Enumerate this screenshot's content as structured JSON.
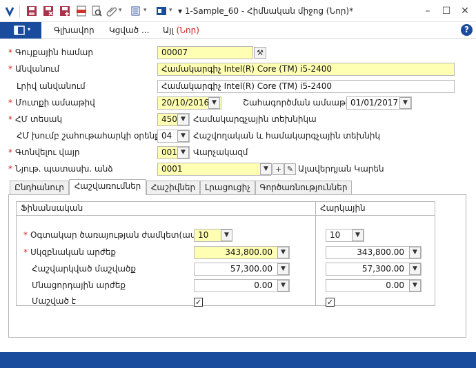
{
  "window": {
    "title": "▾ 1-Sample_60 - Հիմնական միջոց (Նոր)*",
    "minimize": "–",
    "maximize": "☐",
    "close": "✕"
  },
  "menu": {
    "items": [
      "Գլխավոր",
      "Կցված ...",
      "Այլ"
    ],
    "new_suffix": "(Նոր)",
    "help": "?"
  },
  "form": {
    "inventory_label": "Գույքային համար",
    "inventory_value": "00007",
    "name_label": "Անվանում",
    "name_value": "Համակարգիչ Intel(R) Core (TM) i5-2400",
    "fullname_label": "Լրիվ անվանում",
    "fullname_value": "Համակարգիչ Intel(R) Core (TM) i5-2400",
    "entry_date_label": "Մուտքի ամսաթիվ",
    "entry_date_value": "20/10/2016",
    "use_date_label": "Շահագործման ամսաթիվ",
    "use_date_value": "01/01/2017",
    "type_label": "ՀՄ տեսակ",
    "type_value": "450",
    "type_desc": "Համակարգչային տեխնիկա",
    "group_label": "ՀՄ խումբ շահութահարկի օրենքով",
    "group_value": "04",
    "group_desc": "Հաշվողական և համակարգչային տեխնիկ",
    "location_label": "Գտնվելու վայր",
    "location_value": "001",
    "location_desc": "Վարչակազմ",
    "responsible_label": "Նյութ. պատասխ. անձ",
    "responsible_value": "0001",
    "responsible_desc": "Ալավերդյան Կարեն",
    "required_mark": "*"
  },
  "tabs": [
    "Ընդհանուր",
    "Հաշվառումներ",
    "Հաշիվներ",
    "Լրացուցիչ",
    "Գործառնություններ"
  ],
  "financial": {
    "title": "Ֆինանսական",
    "life_label": "Օգտակար ծառայության ժամկետ(ամիս)",
    "life_value": "10",
    "initial_label": "Սկզբնական արժեք",
    "initial_value": "343,800.00",
    "depreciation_label": "Հաշվարկված մաշվածք",
    "depreciation_value": "57,300.00",
    "residual_label": "Մնացորդային արժեք",
    "residual_value": "0.00",
    "worn_label": "Մաշված է",
    "worn_checked": "✓"
  },
  "tax": {
    "title": "Հարկային",
    "life_value": "10",
    "initial_value": "343,800.00",
    "depreciation_value": "57,300.00",
    "residual_value": "0.00",
    "worn_checked": "✓"
  },
  "colors": {
    "accent": "#1a4c9e",
    "required": "#d02020",
    "field_yellow": "#ffffb3"
  }
}
